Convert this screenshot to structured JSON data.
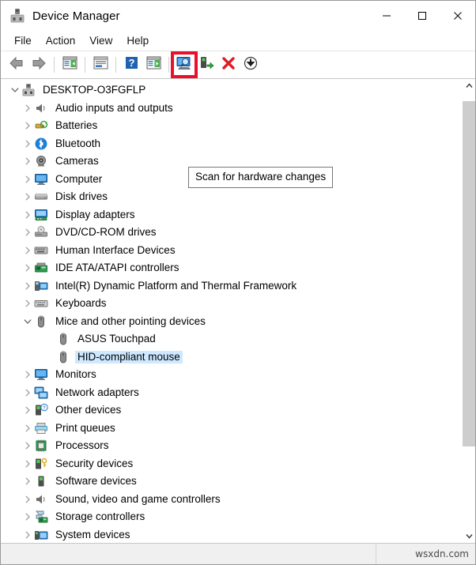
{
  "window": {
    "title": "Device Manager",
    "icon": "device-manager-icon",
    "controls": {
      "minimize": "—",
      "maximize": "□",
      "close": "✕"
    }
  },
  "menubar": {
    "items": [
      {
        "label": "File",
        "name": "menu-file"
      },
      {
        "label": "Action",
        "name": "menu-action"
      },
      {
        "label": "View",
        "name": "menu-view"
      },
      {
        "label": "Help",
        "name": "menu-help"
      }
    ]
  },
  "toolbar": {
    "buttons": [
      {
        "name": "back-button",
        "icon": "back-arrow-icon"
      },
      {
        "name": "forward-button",
        "icon": "forward-arrow-icon"
      },
      {
        "name": "show-hide-console-tree-button",
        "icon": "console-tree-icon"
      },
      {
        "name": "properties-button",
        "icon": "properties-icon"
      },
      {
        "name": "help-button",
        "icon": "question-mark-icon"
      },
      {
        "name": "show-hide-action-pane-button",
        "icon": "action-pane-icon"
      },
      {
        "name": "scan-for-hardware-changes-button",
        "icon": "scan-hardware-icon"
      },
      {
        "name": "update-driver-button",
        "icon": "update-driver-icon"
      },
      {
        "name": "uninstall-device-button",
        "icon": "red-x-icon"
      },
      {
        "name": "disable-device-button",
        "icon": "down-arrow-circle-icon"
      }
    ],
    "highlight_color": "#e8112a"
  },
  "tooltip": {
    "text": "Scan for hardware changes",
    "visible": true
  },
  "tree": {
    "selection_color": "#cde8ff",
    "nodes": [
      {
        "label": "DESKTOP-O3FGFLP",
        "level": 0,
        "state": "expanded",
        "icon": "computer-root-icon",
        "name": "tree-item-desktop-o3fgflp"
      },
      {
        "label": "Audio inputs and outputs",
        "level": 1,
        "state": "collapsed",
        "icon": "speaker-icon",
        "name": "tree-item-audio-inputs-and-outputs"
      },
      {
        "label": "Batteries",
        "level": 1,
        "state": "collapsed",
        "icon": "battery-icon",
        "name": "tree-item-batteries"
      },
      {
        "label": "Bluetooth",
        "level": 1,
        "state": "collapsed",
        "icon": "bluetooth-icon",
        "name": "tree-item-bluetooth"
      },
      {
        "label": "Cameras",
        "level": 1,
        "state": "collapsed",
        "icon": "camera-icon",
        "name": "tree-item-cameras"
      },
      {
        "label": "Computer",
        "level": 1,
        "state": "collapsed",
        "icon": "monitor-icon",
        "name": "tree-item-computer"
      },
      {
        "label": "Disk drives",
        "level": 1,
        "state": "collapsed",
        "icon": "disk-drive-icon",
        "name": "tree-item-disk-drives"
      },
      {
        "label": "Display adapters",
        "level": 1,
        "state": "collapsed",
        "icon": "display-adapter-icon",
        "name": "tree-item-display-adapters"
      },
      {
        "label": "DVD/CD-ROM drives",
        "level": 1,
        "state": "collapsed",
        "icon": "dvd-drive-icon",
        "name": "tree-item-dvd-cd-rom-drives"
      },
      {
        "label": "Human Interface Devices",
        "level": 1,
        "state": "collapsed",
        "icon": "hid-icon",
        "name": "tree-item-human-interface-devices"
      },
      {
        "label": "IDE ATA/ATAPI controllers",
        "level": 1,
        "state": "collapsed",
        "icon": "ide-controller-icon",
        "name": "tree-item-ide-ata-atapi-controllers"
      },
      {
        "label": "Intel(R) Dynamic Platform and Thermal Framework",
        "level": 1,
        "state": "collapsed",
        "icon": "thermal-framework-icon",
        "name": "tree-item-intel-dynamic-platform"
      },
      {
        "label": "Keyboards",
        "level": 1,
        "state": "collapsed",
        "icon": "keyboard-icon",
        "name": "tree-item-keyboards"
      },
      {
        "label": "Mice and other pointing devices",
        "level": 1,
        "state": "expanded",
        "icon": "mouse-icon",
        "name": "tree-item-mice-and-other-pointing-devices"
      },
      {
        "label": "ASUS Touchpad",
        "level": 2,
        "state": "leaf",
        "icon": "mouse-icon",
        "name": "tree-item-asus-touchpad"
      },
      {
        "label": "HID-compliant mouse",
        "level": 2,
        "state": "leaf",
        "icon": "mouse-icon",
        "name": "tree-item-hid-compliant-mouse",
        "selected": true
      },
      {
        "label": "Monitors",
        "level": 1,
        "state": "collapsed",
        "icon": "monitor-icon",
        "name": "tree-item-monitors"
      },
      {
        "label": "Network adapters",
        "level": 1,
        "state": "collapsed",
        "icon": "network-adapter-icon",
        "name": "tree-item-network-adapters"
      },
      {
        "label": "Other devices",
        "level": 1,
        "state": "collapsed",
        "icon": "other-device-icon",
        "name": "tree-item-other-devices"
      },
      {
        "label": "Print queues",
        "level": 1,
        "state": "collapsed",
        "icon": "printer-icon",
        "name": "tree-item-print-queues"
      },
      {
        "label": "Processors",
        "level": 1,
        "state": "collapsed",
        "icon": "processor-icon",
        "name": "tree-item-processors"
      },
      {
        "label": "Security devices",
        "level": 1,
        "state": "collapsed",
        "icon": "security-key-icon",
        "name": "tree-item-security-devices"
      },
      {
        "label": "Software devices",
        "level": 1,
        "state": "collapsed",
        "icon": "software-device-icon",
        "name": "tree-item-software-devices"
      },
      {
        "label": "Sound, video and game controllers",
        "level": 1,
        "state": "collapsed",
        "icon": "speaker-icon",
        "name": "tree-item-sound-video-and-game-controllers"
      },
      {
        "label": "Storage controllers",
        "level": 1,
        "state": "collapsed",
        "icon": "storage-controller-icon",
        "name": "tree-item-storage-controllers"
      },
      {
        "label": "System devices",
        "level": 1,
        "state": "collapsed",
        "icon": "system-device-icon",
        "name": "tree-item-system-devices"
      }
    ]
  },
  "scrollbar": {
    "up_arrow": "∧",
    "down_arrow": "∨",
    "thumb_top_percent": 2,
    "thumb_height_percent": 79
  },
  "statusbar": {
    "watermark": "wsxdn.com"
  }
}
